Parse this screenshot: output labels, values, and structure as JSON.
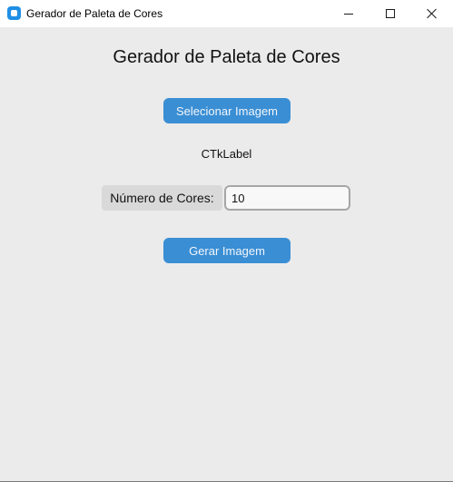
{
  "window": {
    "title": "Gerador de Paleta de Cores",
    "icon": "app-icon",
    "controls": [
      "minimize-icon",
      "maximize-icon",
      "close-icon"
    ]
  },
  "main": {
    "heading": "Gerador de Paleta de Cores",
    "select_image_label": "Selecionar Imagem",
    "status_label": "CTkLabel",
    "color_count_label": "Número de Cores:",
    "color_count_value": "10",
    "generate_label": "Gerar Imagem"
  },
  "colors": {
    "background": "#ebebeb",
    "button": "#3a8ed4",
    "button_text": "#f2f6fb",
    "label_bg": "#d9d9d9",
    "input_border": "#a6a6a6"
  }
}
